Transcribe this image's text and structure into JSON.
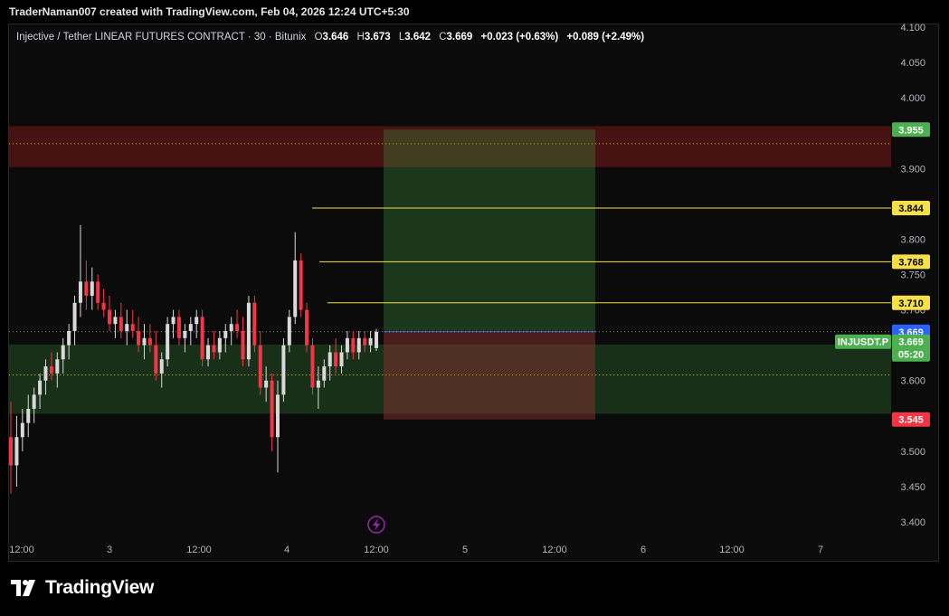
{
  "header": {
    "credit": "TraderNaman007 created with TradingView.com, Feb 04, 2026 12:24 UTC+5:30"
  },
  "legend": {
    "symbol": "Injective / Tether LINEAR FUTURES CONTRACT · 30 · Bitunix",
    "o_label": "O",
    "o": "3.646",
    "h_label": "H",
    "h": "3.673",
    "l_label": "L",
    "l": "3.642",
    "c_label": "C",
    "c": "3.669",
    "change": "+0.023 (+0.63%)",
    "change2": "+0.089 (+2.49%)"
  },
  "brand": {
    "name": "TradingView"
  },
  "colors": {
    "up": "#d9d9d9",
    "down": "#f23645",
    "yellow": "#f5e04a",
    "green_tag": "#4caf50",
    "blue_tag": "#2962ff",
    "red_tag": "#f23645",
    "axis_text": "#b2b5be"
  },
  "chart_data": {
    "type": "candlestick",
    "symbol": "INJUSDT.P",
    "timeframe": "30",
    "y_ticks": [
      "3.400",
      "3.450",
      "3.500",
      "3.550",
      "3.600",
      "3.650",
      "3.700",
      "3.750",
      "3.800",
      "3.850",
      "3.900",
      "3.950",
      "4.000",
      "4.050",
      "4.100"
    ],
    "x_ticks": [
      "12:00",
      "3",
      "12:00",
      "4",
      "12:00",
      "5",
      "12:00",
      "6",
      "12:00",
      "7"
    ],
    "ylim": [
      3.38,
      4.1
    ],
    "horizontal_lines": [
      {
        "name": "tp3",
        "value": 3.844,
        "label": "3.844",
        "color": "#f5e04a"
      },
      {
        "name": "tp2",
        "value": 3.768,
        "label": "3.768",
        "color": "#f5e04a"
      },
      {
        "name": "tp1",
        "value": 3.71,
        "label": "3.710",
        "color": "#f5e04a"
      }
    ],
    "price_tags": [
      {
        "name": "resistance-mid",
        "value": 3.955,
        "label": "3.955",
        "color": "#4caf50"
      },
      {
        "name": "last-price",
        "value": 3.669,
        "label": "3.669",
        "color": "#2962ff"
      },
      {
        "name": "stop",
        "value": 3.545,
        "label": "3.545",
        "color": "#f23645"
      }
    ],
    "symbol_tag": {
      "name": "INJUSDT.P",
      "price": "3.669",
      "countdown": "05:20",
      "value": 3.655
    },
    "zones": [
      {
        "name": "supply-zone",
        "top": 3.96,
        "bottom": 3.902,
        "mid": 3.935
      },
      {
        "name": "demand-zone",
        "top": 3.651,
        "bottom": 3.553,
        "mid": 3.608
      }
    ],
    "position": {
      "type": "long",
      "entry": 3.669,
      "target": 3.955,
      "stop": 3.545
    },
    "candles": [
      [
        3.52,
        3.57,
        3.44,
        3.48
      ],
      [
        3.48,
        3.55,
        3.45,
        3.52
      ],
      [
        3.52,
        3.56,
        3.5,
        3.54
      ],
      [
        3.54,
        3.58,
        3.52,
        3.56
      ],
      [
        3.56,
        3.59,
        3.54,
        3.58
      ],
      [
        3.58,
        3.61,
        3.56,
        3.6
      ],
      [
        3.6,
        3.63,
        3.58,
        3.62
      ],
      [
        3.62,
        3.64,
        3.6,
        3.61
      ],
      [
        3.61,
        3.64,
        3.59,
        3.63
      ],
      [
        3.63,
        3.66,
        3.61,
        3.65
      ],
      [
        3.65,
        3.68,
        3.63,
        3.67
      ],
      [
        3.67,
        3.72,
        3.65,
        3.71
      ],
      [
        3.71,
        3.82,
        3.69,
        3.74
      ],
      [
        3.74,
        3.77,
        3.7,
        3.72
      ],
      [
        3.72,
        3.76,
        3.7,
        3.74
      ],
      [
        3.74,
        3.75,
        3.7,
        3.71
      ],
      [
        3.71,
        3.73,
        3.69,
        3.7
      ],
      [
        3.7,
        3.72,
        3.67,
        3.68
      ],
      [
        3.68,
        3.7,
        3.66,
        3.69
      ],
      [
        3.69,
        3.71,
        3.66,
        3.67
      ],
      [
        3.67,
        3.7,
        3.65,
        3.68
      ],
      [
        3.68,
        3.7,
        3.66,
        3.67
      ],
      [
        3.67,
        3.69,
        3.64,
        3.65
      ],
      [
        3.65,
        3.68,
        3.63,
        3.66
      ],
      [
        3.66,
        3.68,
        3.64,
        3.65
      ],
      [
        3.65,
        3.67,
        3.6,
        3.61
      ],
      [
        3.61,
        3.64,
        3.59,
        3.63
      ],
      [
        3.63,
        3.69,
        3.62,
        3.68
      ],
      [
        3.68,
        3.7,
        3.66,
        3.69
      ],
      [
        3.69,
        3.7,
        3.65,
        3.66
      ],
      [
        3.66,
        3.68,
        3.64,
        3.67
      ],
      [
        3.67,
        3.69,
        3.65,
        3.68
      ],
      [
        3.68,
        3.7,
        3.66,
        3.69
      ],
      [
        3.69,
        3.7,
        3.62,
        3.63
      ],
      [
        3.63,
        3.66,
        3.62,
        3.65
      ],
      [
        3.65,
        3.67,
        3.63,
        3.64
      ],
      [
        3.64,
        3.67,
        3.63,
        3.66
      ],
      [
        3.66,
        3.68,
        3.64,
        3.67
      ],
      [
        3.67,
        3.69,
        3.65,
        3.68
      ],
      [
        3.68,
        3.7,
        3.66,
        3.67
      ],
      [
        3.67,
        3.69,
        3.62,
        3.63
      ],
      [
        3.63,
        3.72,
        3.62,
        3.71
      ],
      [
        3.71,
        3.72,
        3.64,
        3.65
      ],
      [
        3.65,
        3.67,
        3.58,
        3.59
      ],
      [
        3.59,
        3.62,
        3.57,
        3.6
      ],
      [
        3.6,
        3.61,
        3.5,
        3.52
      ],
      [
        3.52,
        3.6,
        3.47,
        3.58
      ],
      [
        3.58,
        3.66,
        3.57,
        3.65
      ],
      [
        3.65,
        3.7,
        3.64,
        3.69
      ],
      [
        3.69,
        3.81,
        3.68,
        3.77
      ],
      [
        3.77,
        3.78,
        3.69,
        3.7
      ],
      [
        3.7,
        3.71,
        3.64,
        3.65
      ],
      [
        3.65,
        3.66,
        3.58,
        3.59
      ],
      [
        3.59,
        3.62,
        3.56,
        3.6
      ],
      [
        3.6,
        3.63,
        3.59,
        3.62
      ],
      [
        3.62,
        3.65,
        3.6,
        3.64
      ],
      [
        3.64,
        3.66,
        3.61,
        3.62
      ],
      [
        3.62,
        3.65,
        3.61,
        3.64
      ],
      [
        3.64,
        3.67,
        3.63,
        3.66
      ],
      [
        3.66,
        3.67,
        3.63,
        3.64
      ],
      [
        3.64,
        3.67,
        3.63,
        3.66
      ],
      [
        3.66,
        3.67,
        3.64,
        3.65
      ],
      [
        3.65,
        3.67,
        3.64,
        3.66
      ],
      [
        3.646,
        3.673,
        3.642,
        3.669
      ]
    ]
  }
}
